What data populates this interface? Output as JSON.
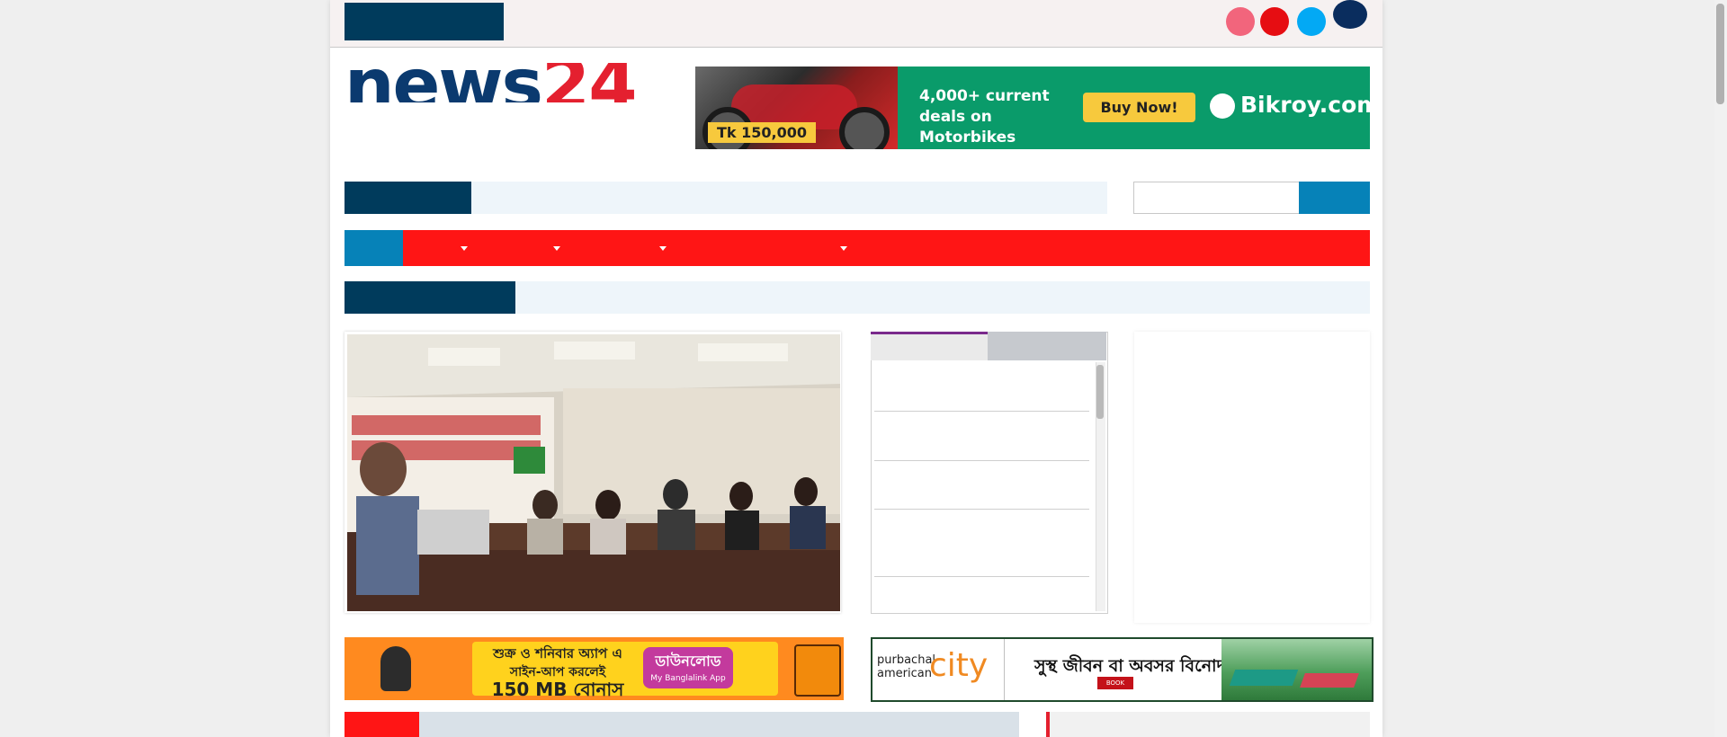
{
  "header": {
    "logo": {
      "news": "news",
      "number": "24"
    }
  },
  "social": [
    "instagram-icon",
    "youtube-icon",
    "twitter-icon",
    "facebook-icon"
  ],
  "ads": {
    "top": {
      "price": "Tk 150,000",
      "headline": "4,000+ current deals on Motorbikes",
      "cta": "Buy Now!",
      "brand": "Bikroy.com"
    },
    "banglalink": {
      "line1": "শুক্র ও শনিবার অ্যাপ এ",
      "line2": "সাইন-আপ করলেই",
      "line3": "150 MB বোনাস",
      "button_main": "ডাউনলোড",
      "button_sub": "My Banglalink App"
    },
    "purbachal": {
      "brand_small": "purbachal american",
      "brand_big": "city",
      "text": "সুস্থ জীবন বা অবসর বিনোদন !",
      "book": "BOOK NOW"
    }
  },
  "colors": {
    "navy": "#003b5c",
    "red": "#ff1515",
    "blue": "#0682b8",
    "brand_red": "#e4202f",
    "brand_navy": "#0b3a6f"
  }
}
